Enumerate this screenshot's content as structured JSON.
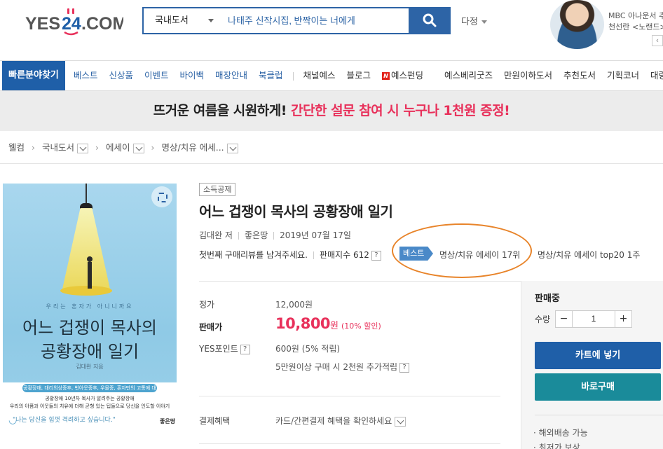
{
  "header": {
    "logo_text": "YES24.COM",
    "search_category": "국내도서",
    "search_query": "나태주 신작시집, 반짝이는 너에게",
    "dajeong_label": "다정",
    "promo_line1": "MBC 아나운서 추",
    "promo_line2": "천선란 <노랜드>",
    "promo_next": "‹"
  },
  "nav": {
    "quick_label": "빠른분야찾기",
    "items": [
      "베스트",
      "신상품",
      "이벤트",
      "바이백",
      "매장안내",
      "북클럽"
    ],
    "items_plain": [
      "채널예스",
      "블로그"
    ],
    "funding_label": "예스펀딩",
    "funding_icon": "N",
    "right_items": [
      "예스베리굿즈",
      "만원이하도서",
      "추천도서",
      "기획코너",
      "대량/"
    ]
  },
  "banner": {
    "part1": "뜨거운 여름을 시원하게!",
    "part2": "간단한 설문 참여 시 누구나 1천원 증정!"
  },
  "breadcrumb": [
    "웰컴",
    "국내도서",
    "에세이",
    "명상/치유 에세..."
  ],
  "cover": {
    "tiny": "우리는 혼자가 아니니까요",
    "title_line1": "어느 겁쟁이 목사의",
    "title_line2": "공황장애 일기",
    "author": "김대완 지음",
    "tag": "공황장애, 대리외상증후, 번아웃증후, 우울증, 혼자만의 고통에 대한 솔직한 이야기",
    "desc_line1": "공황장애 10년차 목사가 알려주는 공황장애",
    "desc_line2": "우리의 아픔과 이웃들의 치유에 더해 균형 있는 팁들으로 당신을 인도할 이야기",
    "quote": "\"나는 당신을 힘껏 격려하고 싶습니다.\"",
    "publisher": "좋은땅"
  },
  "product": {
    "badge": "소득공제",
    "title": "어느 겁쟁이 목사의 공황장애 일기",
    "author": "김대완 저",
    "publisher": "좋은땅",
    "date": "2019년 07월 17일",
    "review_prompt": "첫번째 구매리뷰를 남겨주세요.",
    "sales_index": "판매지수 612",
    "best_label": "베스트",
    "rank1": "명상/치유 에세이 17위",
    "rank2": "명상/치유 에세이 top20 1주"
  },
  "price": {
    "list_label": "정가",
    "list_value": "12,000원",
    "sale_label": "판매가",
    "sale_value": "10,800",
    "sale_unit": "원",
    "discount": "(10% 할인)",
    "points_label": "YES포인트",
    "points_value": "600원 (5% 적립)",
    "extra_points": "5만원이상 구매 시 2천원 추가적립",
    "benefit_label": "결제혜택",
    "benefit_value": "카드/간편결제 혜택을 확인하세요"
  },
  "purchase": {
    "status": "판매중",
    "qty_label": "수량",
    "qty_minus": "−",
    "qty_value": "1",
    "qty_plus": "+",
    "cart_label": "카트에 넣기",
    "buy_label": "바로구매",
    "feature1": "· 해외배송 가능",
    "feature2": "· 최저가 보상"
  },
  "colors": {
    "brand_blue": "#1f5fa8",
    "sale_red": "#e8315b",
    "buy_teal": "#1a8b9a",
    "annotation_orange": "#e8842a"
  }
}
